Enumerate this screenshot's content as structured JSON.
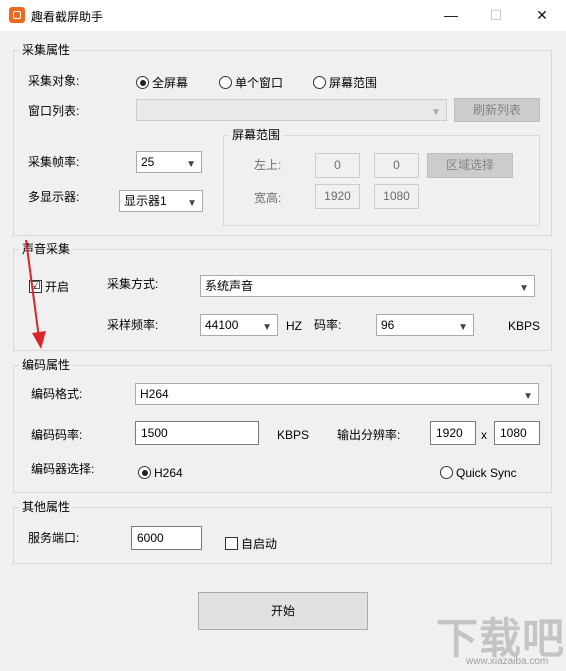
{
  "window": {
    "title": "趣看截屏助手",
    "minimize_glyph": "—",
    "maximize_glyph": "☐",
    "close_glyph": "✕",
    "app_icon": "record-icon"
  },
  "capture": {
    "legend": "采集属性",
    "target_label": "采集对象:",
    "target_options": [
      "全屏幕",
      "单个窗口",
      "屏幕范围"
    ],
    "target_selected": "全屏幕",
    "window_list_label": "窗口列表:",
    "window_list_value": "",
    "refresh_button": "刷新列表",
    "fps_label": "采集帧率:",
    "fps_value": "25",
    "monitor_label": "多显示器:",
    "monitor_value": "显示器1",
    "region": {
      "legend": "屏幕范围",
      "top_left_label": "左上:",
      "left_value": "0",
      "top_value": "0",
      "select_button": "区域选择",
      "size_label": "宽高:",
      "width_value": "1920",
      "height_value": "1080"
    }
  },
  "audio": {
    "legend": "声音采集",
    "enable_label": "开启",
    "enable_checked": true,
    "mode_label": "采集方式:",
    "mode_value": "系统声音",
    "sample_rate_label": "采样频率:",
    "sample_rate_value": "44100",
    "sample_rate_unit": "HZ",
    "bitrate_label": "码率:",
    "bitrate_value": "96",
    "bitrate_unit": "KBPS"
  },
  "encoding": {
    "legend": "编码属性",
    "format_label": "编码格式:",
    "format_value": "H264",
    "bitrate_label": "编码码率:",
    "bitrate_value": "1500",
    "bitrate_unit": "KBPS",
    "resolution_label": "输出分辨率:",
    "res_width": "1920",
    "res_sep": "x",
    "res_height": "1080",
    "encoder_label": "编码器选择:",
    "encoder_options": [
      "H264",
      "Quick Sync"
    ],
    "encoder_selected": "H264"
  },
  "other": {
    "legend": "其他属性",
    "port_label": "服务端口:",
    "port_value": "6000",
    "autostart_label": "自启动",
    "autostart_checked": false
  },
  "start_button": "开始",
  "annotation_color": "#d9262c",
  "watermark": {
    "main": "下载吧",
    "url": "www.xiazaiba.com"
  }
}
